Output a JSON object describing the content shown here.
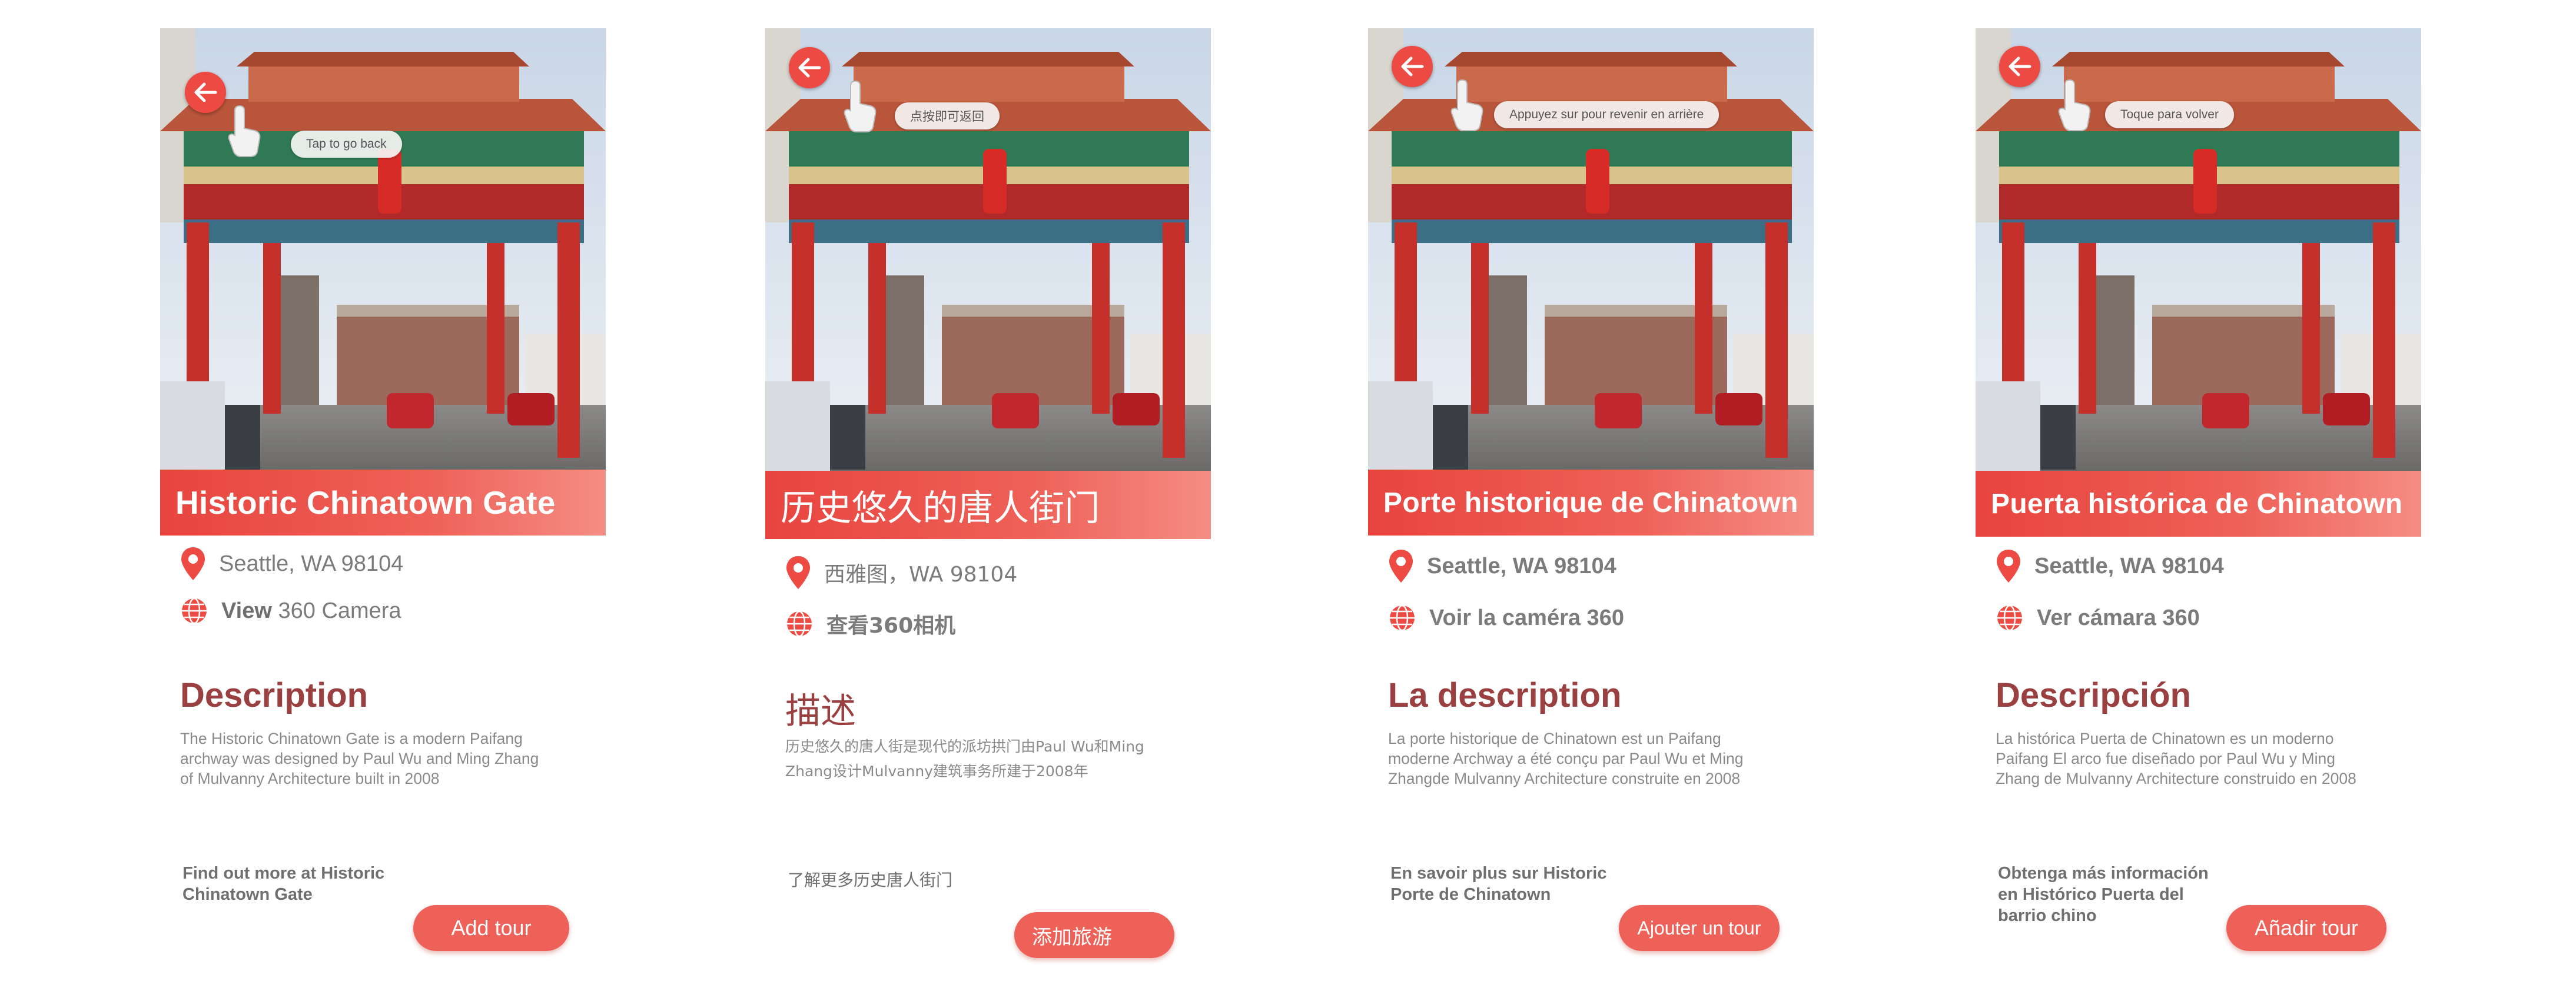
{
  "screens": [
    {
      "lang": "en",
      "title": "Historic Chinatown Gate",
      "hint": "Tap to go back",
      "location": "Seattle, WA 98104",
      "camera_bold": "View",
      "camera_rest": " 360 Camera",
      "description_heading": "Description",
      "description_lines": [
        "The Historic Chinatown Gate is a modern Paifang",
        "archway was designed by Paul Wu and Ming Zhang",
        "of Mulvanny Architecture built in 2008"
      ],
      "more_lines": [
        "Find out more at Historic",
        "Chinatown Gate"
      ],
      "add_tour": "Add tour"
    },
    {
      "lang": "zh",
      "title": "历史悠久的唐人街门",
      "hint": "点按即可返回",
      "location": "西雅图，WA 98104",
      "camera_text": "查看360相机",
      "description_heading": "描述",
      "description_lines": [
        "历史悠久的唐人街是现代的派坊拱门由Paul Wu和Ming",
        "Zhang设计Mulvanny建筑事务所建于2008年"
      ],
      "more_lines": [
        "了解更多历史唐人街门"
      ],
      "add_tour": "添加旅游"
    },
    {
      "lang": "fr",
      "title": "Porte historique de Chinatown",
      "hint": "Appuyez sur pour revenir en arrière",
      "location": "Seattle, WA 98104",
      "camera_text": "Voir la caméra 360",
      "description_heading": "La description",
      "description_lines": [
        "La porte historique de Chinatown est un Paifang",
        "moderne Archway a été conçu par Paul Wu et Ming",
        "Zhangde Mulvanny Architecture construite en 2008"
      ],
      "more_lines": [
        "En savoir plus sur Historic",
        "Porte de Chinatown"
      ],
      "add_tour": "Ajouter un tour"
    },
    {
      "lang": "es",
      "title": "Puerta histórica de Chinatown",
      "hint": "Toque para volver",
      "location": "Seattle, WA 98104",
      "camera_text": "Ver cámara 360",
      "description_heading": "Descripción",
      "description_lines": [
        "La histórica Puerta de Chinatown es un moderno",
        "Paifang El arco fue diseñado por Paul Wu y Ming",
        "Zhang de Mulvanny Architecture construido en 2008"
      ],
      "more_lines": [
        "Obtenga más información",
        "en Histórico Puerta del",
        "barrio chino"
      ],
      "add_tour": "Añadir tour"
    }
  ],
  "icons": {
    "back": "back-arrow-icon",
    "hand": "hand-pointer-icon",
    "location": "location-pin-icon",
    "camera": "globe-360-icon"
  },
  "colors": {
    "accent": "#ec4a43",
    "heading": "#9a4040",
    "text": "#7b7b7b"
  }
}
